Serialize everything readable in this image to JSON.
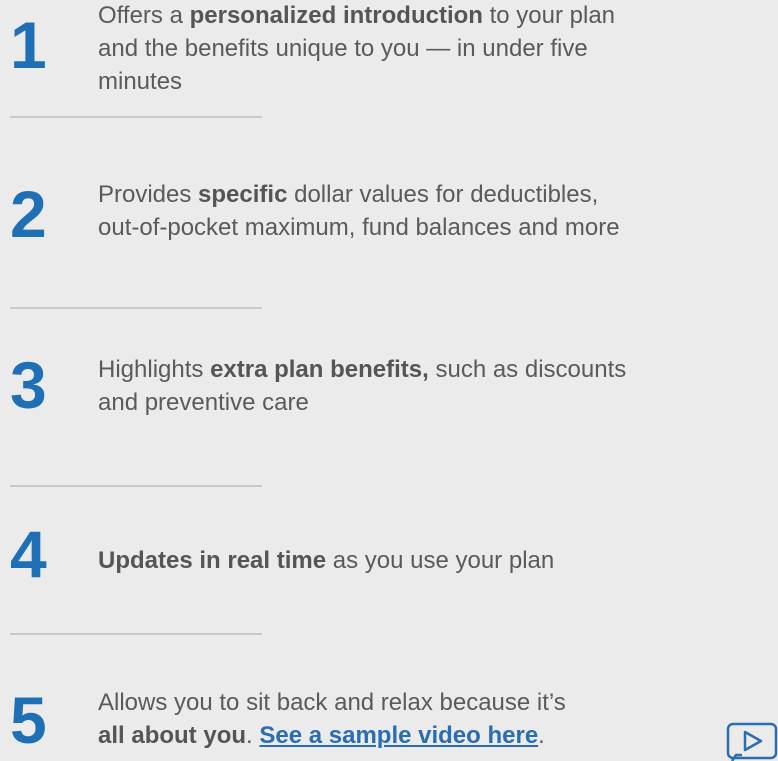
{
  "features": [
    {
      "number": "1",
      "parts": [
        {
          "text": "Offers a ",
          "style": "plain"
        },
        {
          "text": "personalized introduction",
          "style": "bold"
        },
        {
          "text": " to your plan",
          "style": "plain"
        }
      ],
      "line2": "and the benefits unique to you — in under five",
      "line3": "minutes"
    },
    {
      "number": "2",
      "parts": [
        {
          "text": "Provides ",
          "style": "plain"
        },
        {
          "text": "specific",
          "style": "bold"
        },
        {
          "text": " dollar values for deductibles,",
          "style": "plain"
        }
      ],
      "line2": "out-of-pocket maximum, fund balances and more"
    },
    {
      "number": "3",
      "parts": [
        {
          "text": "Highlights ",
          "style": "plain"
        },
        {
          "text": "extra plan benefits,",
          "style": "bold"
        },
        {
          "text": " such as discounts",
          "style": "plain"
        }
      ],
      "line2": "and preventive care"
    },
    {
      "number": "4",
      "parts": [
        {
          "text": "Updates in real time",
          "style": "bold"
        },
        {
          "text": " as you use your plan",
          "style": "plain"
        }
      ]
    },
    {
      "number": "5",
      "line1": "Allows you to sit back and relax because it’s",
      "line2_bold": "all about you",
      "line2_sep": ". ",
      "link_text": "See a sample video here",
      "line2_end": "."
    }
  ],
  "icons": {
    "video": "video-play-icon"
  },
  "colors": {
    "background": "#ebebeb",
    "number": "#1f6fb6",
    "text": "#5a5a5a",
    "link": "#2a6db0",
    "divider": "#c9c9c9"
  }
}
